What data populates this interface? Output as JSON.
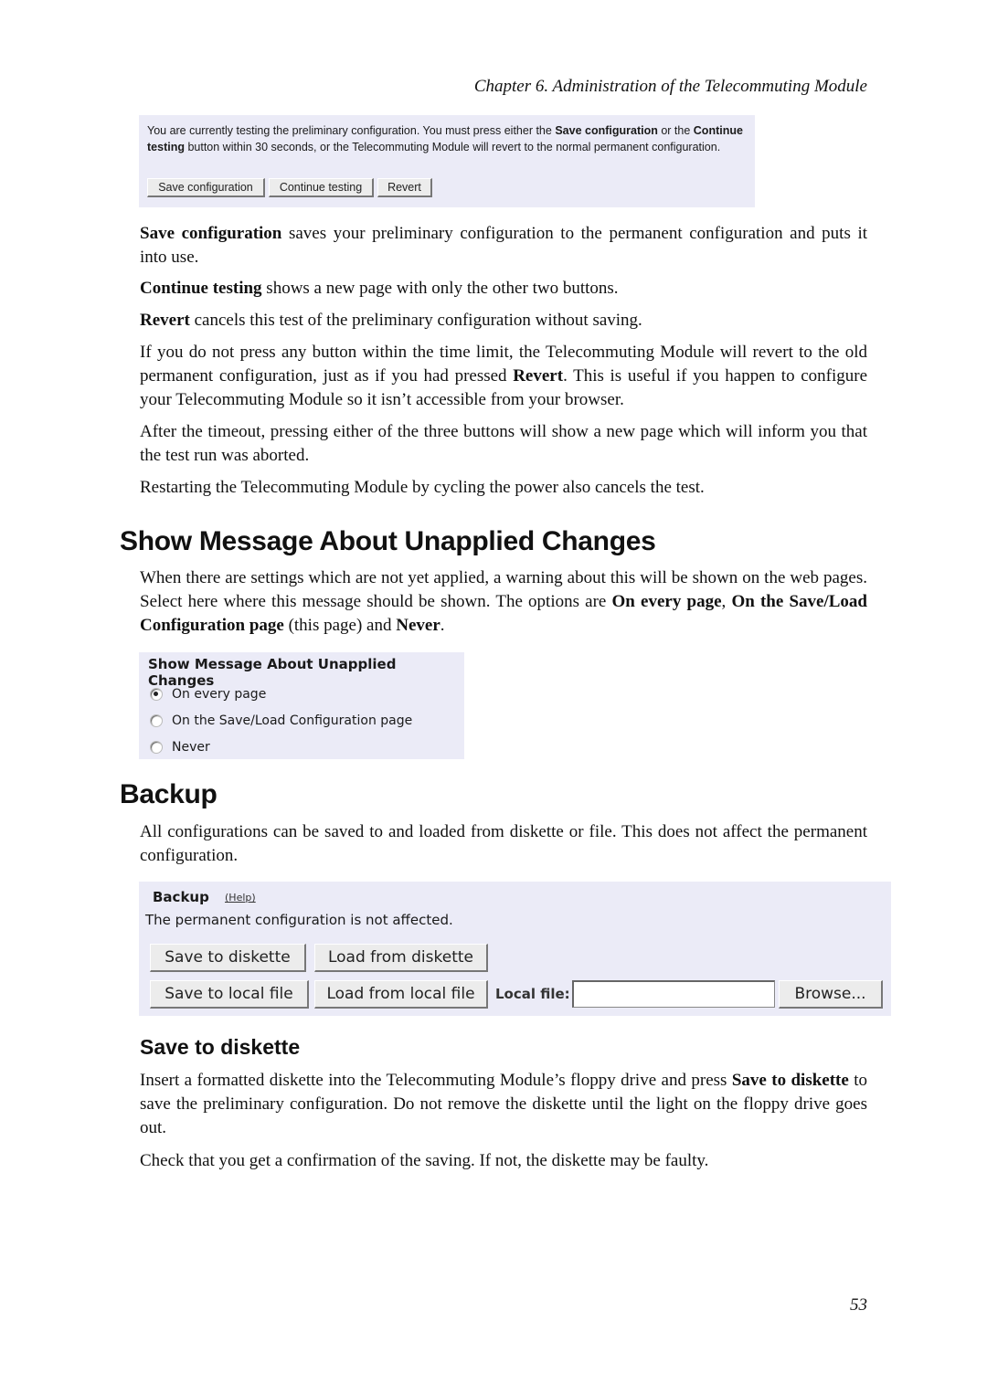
{
  "running_head": "Chapter 6. Administration of the Telecommuting Module",
  "testing_panel": {
    "message_parts": [
      "You are currently testing the preliminary configuration. You must press either the ",
      "Save configuration",
      " or the ",
      "Continue testing",
      " button within 30 seconds, or the Telecommuting Module will revert to the normal permanent configuration."
    ],
    "buttons": [
      "Save configuration",
      "Continue testing",
      "Revert"
    ]
  },
  "paragraphs_1": [
    {
      "bold": "Save configuration",
      "text": " saves your preliminary configuration to the permanent configuration and puts it into use."
    },
    {
      "bold": "Continue testing",
      "text": " shows a new page with only the other two buttons."
    },
    {
      "bold": "Revert",
      "text": " cancels this test of the preliminary configuration without saving."
    }
  ],
  "paragraph_timeout": {
    "before": "If you do not press any button within the time limit, the Telecommuting Module will revert to the old permanent configuration, just as if you had pressed ",
    "bold": "Revert",
    "after": ". This is useful if you happen to configure your Telecommuting Module so it isn’t accessible from your browser."
  },
  "paragraph_after_timeout": "After the timeout, pressing either of the three buttons will show a new page which will inform you that the test run was aborted.",
  "paragraph_restart": "Restarting the Telecommuting Module by cycling the power also cancels the test.",
  "section_unapplied": {
    "heading": "Show Message About Unapplied Changes",
    "intro_parts": [
      "When there are settings which are not yet applied, a warning about this will be shown on the web pages. Select here where this message should be shown. The options are ",
      "On every page",
      ", ",
      "On the Save/Load Configuration page",
      " (this page) and ",
      "Never",
      "."
    ],
    "panel_title": "Show Message About Unapplied Changes",
    "options": [
      {
        "label": "On every page",
        "selected": true
      },
      {
        "label": "On the Save/Load Configuration page",
        "selected": false
      },
      {
        "label": "Never",
        "selected": false
      }
    ]
  },
  "section_backup": {
    "heading": "Backup",
    "intro": "All configurations can be saved to and loaded from diskette or file. This does not affect the permanent configuration.",
    "panel_title": "Backup",
    "help_link": "(Help)",
    "panel_note": "The permanent configuration is not affected.",
    "buttons": {
      "save_diskette": "Save to diskette",
      "load_diskette": "Load from diskette",
      "save_local": "Save to local file",
      "load_local": "Load from local file",
      "browse": "Browse..."
    },
    "local_file_label": "Local file:",
    "local_file_value": ""
  },
  "section_save_diskette": {
    "heading": "Save to diskette",
    "p1_parts": [
      "Insert a formatted diskette into the Telecommuting Module’s floppy drive and press ",
      "Save to diskette",
      " to save the preliminary configuration. Do not remove the diskette until the light on the floppy drive goes out."
    ],
    "p2": "Check that you get a confirmation of the saving. If not, the diskette may be faulty."
  },
  "page_number": "53"
}
